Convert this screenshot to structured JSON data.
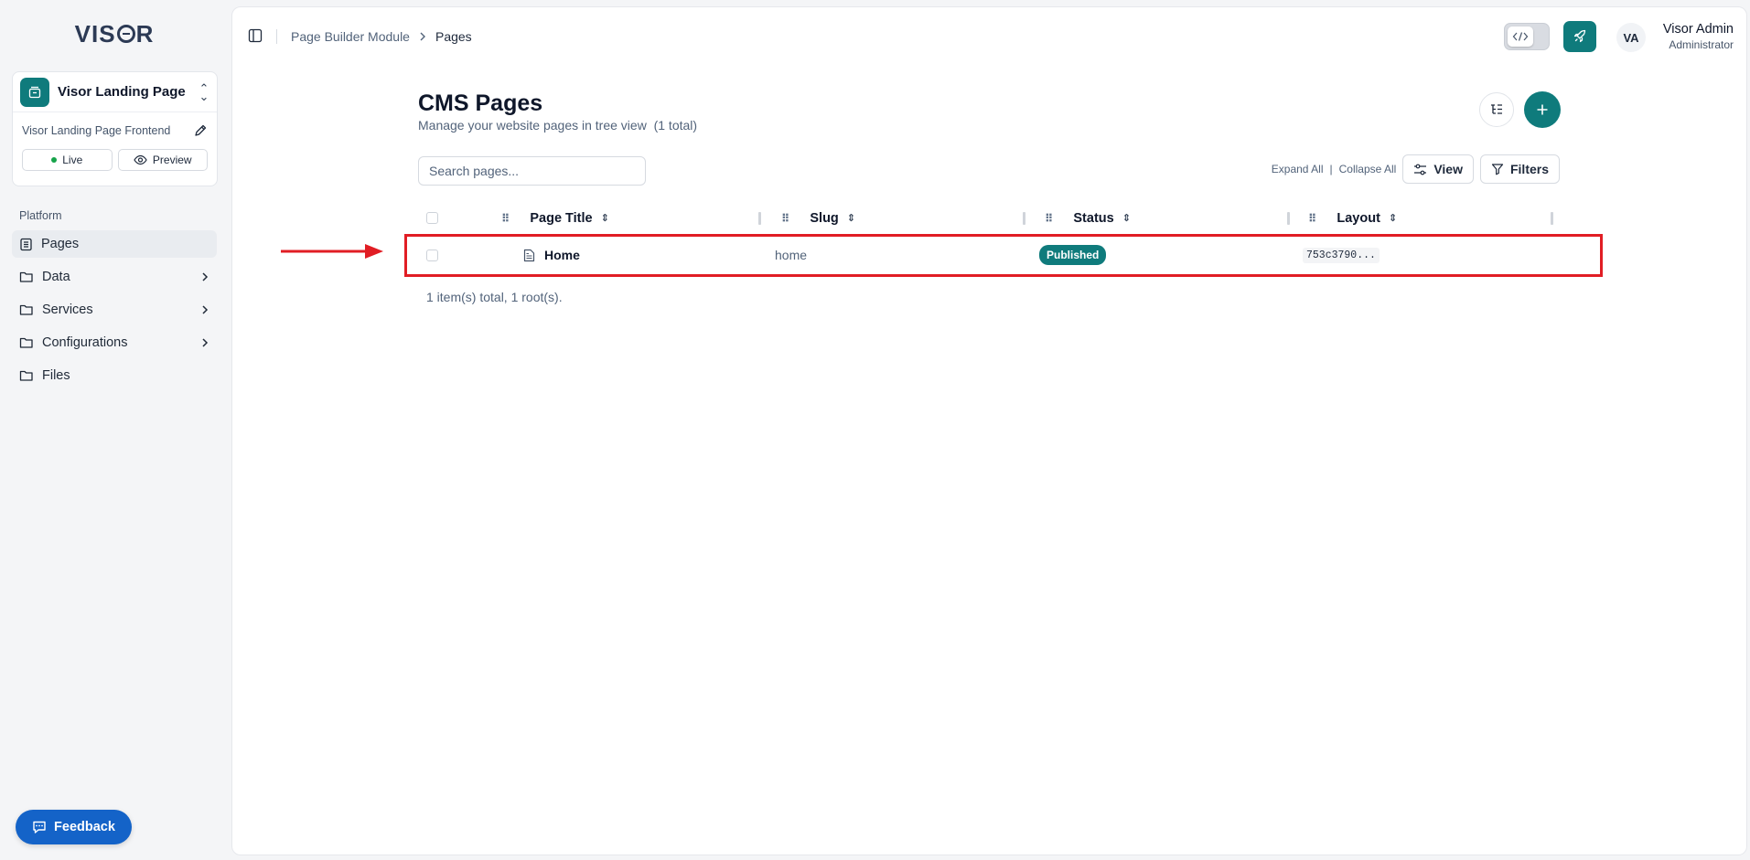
{
  "app": {
    "logo_text": "VISOR",
    "accent": "#0f7b7c"
  },
  "project": {
    "name": "Visor Landing Page",
    "subtitle": "Visor Landing Page Frontend",
    "live_label": "Live",
    "preview_label": "Preview"
  },
  "sidebar": {
    "heading": "Platform",
    "items": [
      {
        "label": "Pages",
        "icon": "page-list-icon",
        "active": true
      },
      {
        "label": "Data",
        "icon": "folder-icon",
        "expandable": true
      },
      {
        "label": "Services",
        "icon": "folder-icon",
        "expandable": true
      },
      {
        "label": "Configurations",
        "icon": "folder-icon",
        "expandable": true
      },
      {
        "label": "Files",
        "icon": "folder-icon"
      }
    ],
    "feedback_label": "Feedback"
  },
  "header": {
    "breadcrumb": [
      "Page Builder Module",
      "Pages"
    ],
    "user_initials": "VA",
    "user_name": "Visor Admin",
    "user_role": "Administrator"
  },
  "main": {
    "title": "CMS Pages",
    "subtitle": "Manage your website pages in tree view  (1 total)",
    "search_placeholder": "Search pages...",
    "expand_all": "Expand All",
    "collapse_all": "Collapse All",
    "separator": "|",
    "view_label": "View",
    "filters_label": "Filters",
    "columns": [
      "Page Title",
      "Slug",
      "Status",
      "Layout"
    ],
    "rows": [
      {
        "title": "Home",
        "slug": "home",
        "status": "Published",
        "layout": "753c3790..."
      }
    ],
    "footer": "1 item(s) total, 1 root(s)."
  }
}
